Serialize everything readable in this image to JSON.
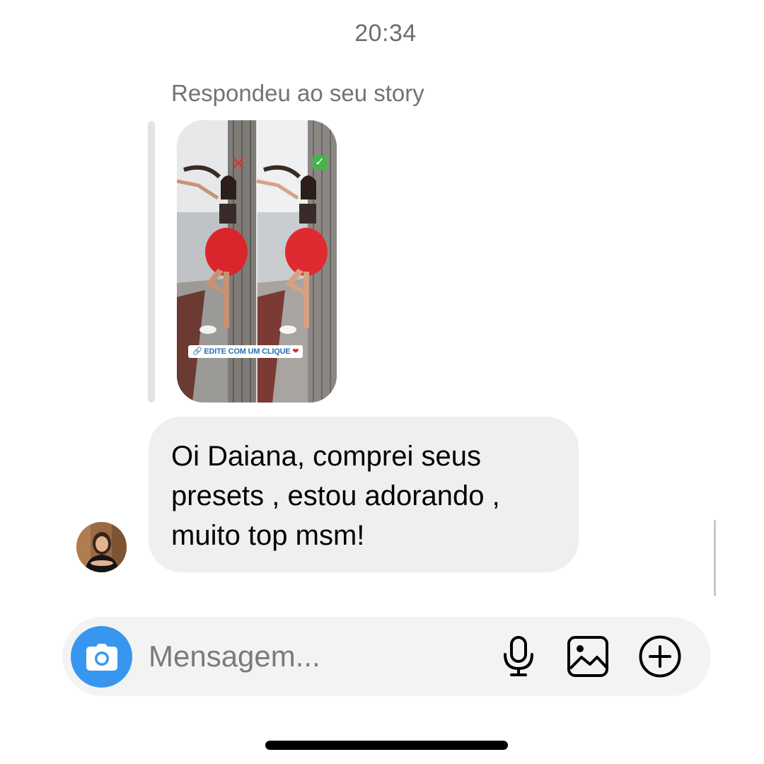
{
  "thread": {
    "timestamp": "20:34",
    "reply_label": "Respondeu ao seu story"
  },
  "story": {
    "caption": "EDITE COM UM CLIQUE",
    "left_mark": "✕",
    "right_mark": "✓"
  },
  "message": {
    "lines": [
      "Oi Daiana, comprei seus",
      "presets , estou adorando ,",
      "muito top msm!"
    ]
  },
  "composer": {
    "placeholder": "Mensagem..."
  },
  "icons": {
    "camera": "camera-icon",
    "mic": "microphone-icon",
    "gallery": "gallery-icon",
    "plus": "plus-circle-icon"
  },
  "colors": {
    "accent": "#3797f0",
    "bubble": "#efefef",
    "composer": "#f3f3f3"
  }
}
